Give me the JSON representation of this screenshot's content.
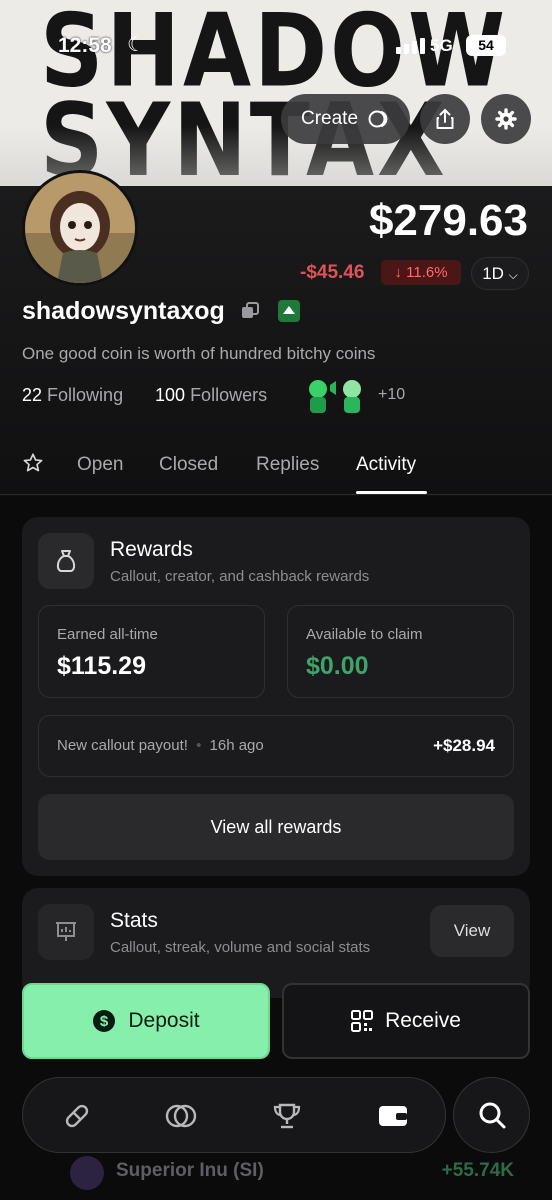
{
  "status_bar": {
    "time": "12:58",
    "network": "5G",
    "battery": "54"
  },
  "banner": {
    "line1": "SHADOW",
    "line2": "SYNTAX"
  },
  "header": {
    "create_label": "Create"
  },
  "profile": {
    "price": "$279.63",
    "change": "-$45.46",
    "change_pct": "↓ 11.6%",
    "timeframe": "1D",
    "username": "shadowsyntaxog",
    "bio": "One good coin is worth of hundred bitchy coins",
    "following_count": "22",
    "following_label": "Following",
    "followers_count": "100",
    "followers_label": "Followers",
    "more_followers": "+10"
  },
  "tabs": [
    "Open",
    "Closed",
    "Replies",
    "Activity"
  ],
  "active_tab": "Activity",
  "rewards": {
    "title": "Rewards",
    "subtitle": "Callout, creator, and cashback rewards",
    "earned_label": "Earned all-time",
    "earned_value": "$115.29",
    "available_label": "Available to claim",
    "available_value": "$0.00",
    "payout_text": "New callout payout!",
    "payout_time": "16h ago",
    "payout_amount": "+$28.94",
    "view_all_label": "View all rewards"
  },
  "stats": {
    "title": "Stats",
    "subtitle": "Callout, streak, volume and social stats",
    "view_label": "View"
  },
  "actions": {
    "deposit_label": "Deposit",
    "receive_label": "Receive"
  },
  "peek_row": {
    "name": "Superior Inu (SI)",
    "value": "+55.74K"
  },
  "colors": {
    "accent_green": "#86efac",
    "negative": "#e0525a",
    "available_green": "#3fa46a"
  }
}
